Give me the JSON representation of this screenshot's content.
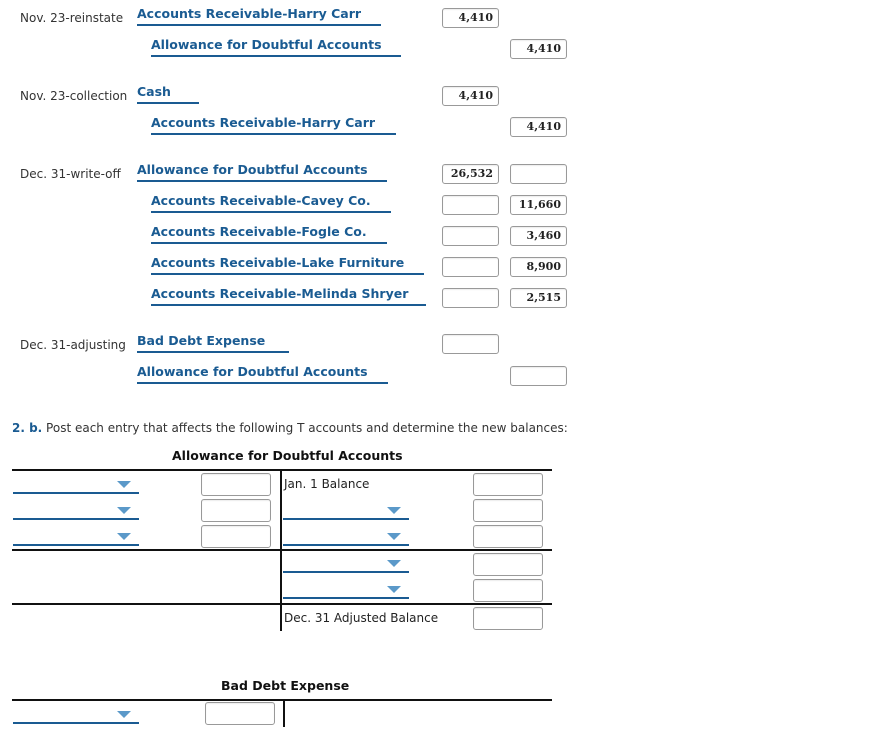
{
  "journal_entries": [
    {
      "date": "Nov. 23-reinstate",
      "lines": [
        {
          "account": "Accounts Receivable-Harry Carr",
          "debit": "4,410",
          "credit": null
        },
        {
          "account": "Allowance for Doubtful Accounts",
          "debit": null,
          "credit": "4,410"
        }
      ]
    },
    {
      "date": "Nov. 23-collection",
      "lines": [
        {
          "account": "Cash",
          "debit": "4,410",
          "credit": null
        },
        {
          "account": "Accounts Receivable-Harry Carr",
          "debit": null,
          "credit": "4,410"
        }
      ]
    },
    {
      "date": "Dec. 31-write-off",
      "lines": [
        {
          "account": "Allowance for Doubtful Accounts",
          "debit": "26,532",
          "credit": ""
        },
        {
          "account": "Accounts Receivable-Cavey Co.",
          "debit": "",
          "credit": "11,660"
        },
        {
          "account": "Accounts Receivable-Fogle Co.",
          "debit": "",
          "credit": "3,460"
        },
        {
          "account": "Accounts Receivable-Lake Furniture",
          "debit": "",
          "credit": "8,900"
        },
        {
          "account": "Accounts Receivable-Melinda Shryer",
          "debit": "",
          "credit": "2,515"
        }
      ]
    },
    {
      "date": "Dec. 31-adjusting",
      "lines": [
        {
          "account": "Bad Debt Expense",
          "debit": "",
          "credit": null
        },
        {
          "account": "Allowance for Doubtful Accounts",
          "debit": null,
          "credit": ""
        }
      ]
    }
  ],
  "instruction": {
    "prefix": "2. b.",
    "text": " Post each entry that affects the following T accounts and determine the new balances:"
  },
  "t_accounts": [
    {
      "title": "Allowance for Doubtful Accounts",
      "left_rows": [
        {
          "select": "",
          "amount": ""
        },
        {
          "select": "",
          "amount": ""
        },
        {
          "select": "",
          "amount": ""
        }
      ],
      "right_rows": [
        {
          "label": "Jan. 1 Balance",
          "amount": ""
        },
        {
          "select": "",
          "amount": ""
        },
        {
          "select": "",
          "amount": ""
        },
        {
          "select": "",
          "amount": ""
        },
        {
          "select": "",
          "amount": ""
        }
      ],
      "ending_label": "Dec. 31 Adjusted Balance",
      "ending_amount": ""
    },
    {
      "title": "Bad Debt Expense",
      "left_rows": [
        {
          "select": "",
          "amount": ""
        }
      ]
    }
  ]
}
